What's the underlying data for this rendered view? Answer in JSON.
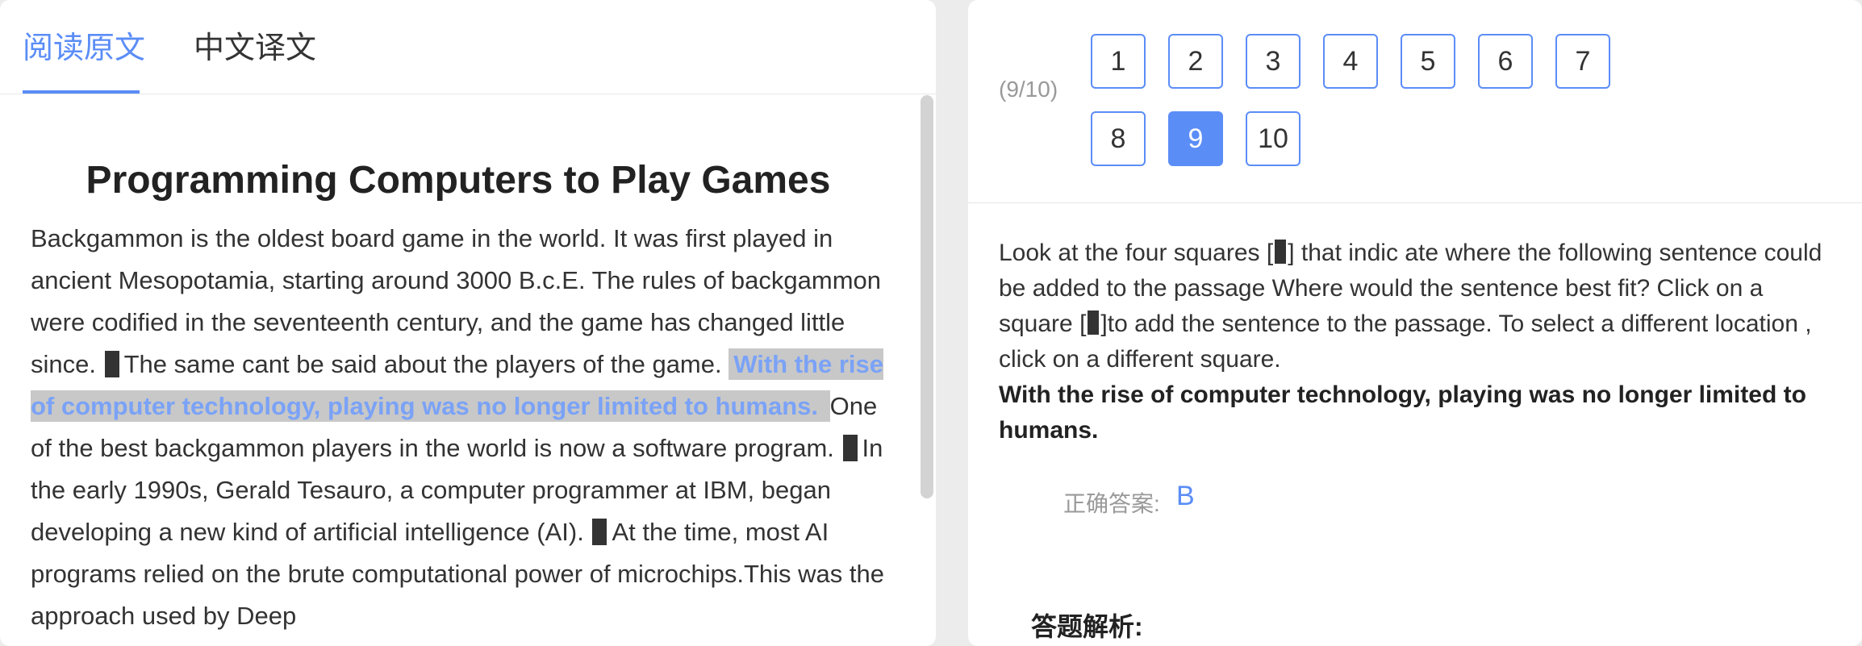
{
  "tabs": {
    "original": "阅读原文",
    "translation": "中文译文"
  },
  "article": {
    "title": "Programming Computers to Play Games",
    "p1": "Backgammon is the oldest board game in the world. It was first played in ancient Mesopotamia, starting around 3000 B.c.E. The rules of backgammon were codified in the seventeenth century, and the game has changed little since. ",
    "p2": "The same cant be said about the players of the game. ",
    "highlight": "With the rise of computer technology, playing was no longer limited to humans. ",
    "p3": "One of the best backgammon players in the world is now a software program. ",
    "p4": "In the early 1990s, Gerald Tesauro, a computer programmer at IBM, began developing a new kind of artificial intelligence (AI). ",
    "p5": "At the time, most AI programs relied on the brute computational power of microchips.This was the approach used by Deep"
  },
  "progress": "(9/10)",
  "question_nav": [
    "1",
    "2",
    "3",
    "4",
    "5",
    "6",
    "7",
    "8",
    "9",
    "10"
  ],
  "current_question": "9",
  "question": {
    "t1": "Look at the four squares [",
    "t2": "] that indic ate where the following sentence could be added to the passage Where would the sentence best fit? Click on a square [",
    "t3": "]to add the sentence to the passage. To select a different location , click on a different square.",
    "sentence": "With the rise of computer technology, playing was no longer limited to humans."
  },
  "answer": {
    "label": "正确答案:",
    "value": "B"
  },
  "analysis_title": "答题解析:",
  "colors": {
    "accent": "#5b8df7",
    "highlight_bg": "#c8c8c8"
  }
}
